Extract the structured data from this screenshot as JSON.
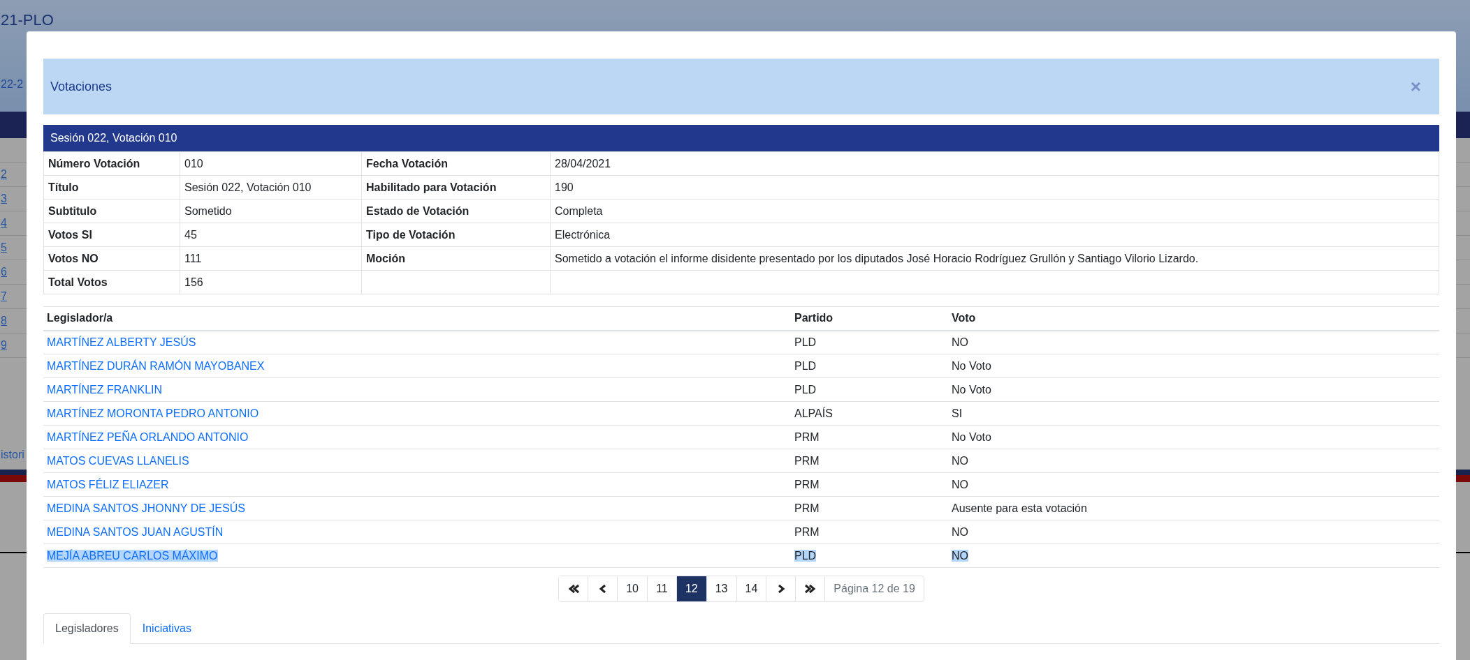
{
  "background_page": {
    "title": "21-PLO",
    "link": "22-2",
    "rows": [
      "2",
      "3",
      "4",
      "5",
      "6",
      "7",
      "8",
      "9"
    ],
    "history_link": "istori"
  },
  "modal": {
    "title": "Votaciones",
    "close": "×"
  },
  "session_header": "Sesión 022, Votación 010",
  "details": [
    {
      "label": "Número Votación",
      "value": "010",
      "label_2": "Fecha Votación",
      "value_2": "28/04/2021"
    },
    {
      "label": "Título",
      "value": "Sesión 022, Votación 010",
      "label_2": "Habilitado para Votación",
      "value_2": "190"
    },
    {
      "label": "Subtitulo",
      "value": "Sometido",
      "label_2": "Estado de Votación",
      "value_2": "Completa"
    },
    {
      "label": "Votos SI",
      "value": "45",
      "label_2": "Tipo de Votación",
      "value_2": "Electrónica"
    },
    {
      "label": "Votos NO",
      "value": "111",
      "label_2": "Moción",
      "value_2": "Sometido a votación el informe disidente presentado por los diputados José Horacio Rodríguez Grullón y Santiago Vilorio Lizardo."
    },
    {
      "label": "Total Votos",
      "value": "156"
    }
  ],
  "legislators": {
    "columns": [
      "Legislador/a",
      "Partido",
      "Voto"
    ],
    "rows": [
      {
        "name": "MARTÍNEZ ALBERTY JESÚS",
        "party": "PLD",
        "vote": "NO",
        "selected": false
      },
      {
        "name": "MARTÍNEZ DURÁN RAMÓN MAYOBANEX",
        "party": "PLD",
        "vote": "No Voto",
        "selected": false
      },
      {
        "name": "MARTÍNEZ FRANKLIN",
        "party": "PLD",
        "vote": "No Voto",
        "selected": false
      },
      {
        "name": "MARTÍNEZ MORONTA PEDRO ANTONIO",
        "party": "ALPAÍS",
        "vote": "SI",
        "selected": false
      },
      {
        "name": "MARTÍNEZ PEÑA ORLANDO ANTONIO",
        "party": "PRM",
        "vote": "No Voto",
        "selected": false
      },
      {
        "name": "MATOS CUEVAS LLANELIS",
        "party": "PRM",
        "vote": "NO",
        "selected": false
      },
      {
        "name": "MATOS FÉLIZ ELIAZER",
        "party": "PRM",
        "vote": "NO",
        "selected": false
      },
      {
        "name": "MEDINA SANTOS JHONNY DE JESÚS",
        "party": "PRM",
        "vote": "Ausente para esta votación",
        "selected": false
      },
      {
        "name": "MEDINA SANTOS JUAN AGUSTÍN",
        "party": "PRM",
        "vote": "NO",
        "selected": false
      },
      {
        "name": "MEJÍA ABREU CARLOS MÁXIMO",
        "party": "PLD",
        "vote": "NO",
        "selected": true
      }
    ]
  },
  "pagination": {
    "items": [
      {
        "kind": "first"
      },
      {
        "kind": "prev"
      },
      {
        "kind": "page",
        "label": "10",
        "selected": false
      },
      {
        "kind": "page",
        "label": "11",
        "selected": false
      },
      {
        "kind": "page",
        "label": "12",
        "selected": true
      },
      {
        "kind": "page",
        "label": "13",
        "selected": false
      },
      {
        "kind": "page",
        "label": "14",
        "selected": false
      },
      {
        "kind": "next"
      },
      {
        "kind": "last"
      }
    ],
    "info": "Página 12 de 19"
  },
  "tabs": [
    {
      "label": "Legisladores",
      "selected": true
    },
    {
      "label": "Iniciativas",
      "selected": false
    }
  ]
}
